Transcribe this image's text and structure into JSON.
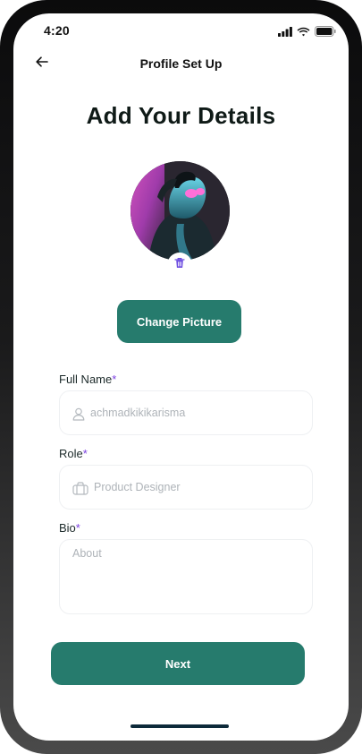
{
  "status_bar": {
    "time": "4:20",
    "icons": [
      "signal-icon",
      "wifi-icon",
      "battery-icon"
    ]
  },
  "header": {
    "title": "Profile Set Up",
    "back_icon": "arrow-left-icon"
  },
  "page": {
    "heading": "Add Your Details"
  },
  "avatar": {
    "delete_icon": "trash-icon"
  },
  "actions": {
    "change_picture_label": "Change Picture",
    "next_label": "Next"
  },
  "form": {
    "full_name": {
      "label": "Full Name",
      "required_mark": "*",
      "placeholder": "achmadkikikarisma",
      "value": "",
      "icon": "user-icon"
    },
    "role": {
      "label": "Role",
      "required_mark": "*",
      "placeholder": "Product Designer",
      "value": "",
      "icon": "briefcase-icon"
    },
    "bio": {
      "label": "Bio",
      "required_mark": "*",
      "placeholder": "About",
      "value": ""
    }
  },
  "colors": {
    "primary": "#267b6d",
    "required": "#7b3fe0",
    "delete": "#6b4be0",
    "heading": "#0f1a17"
  }
}
